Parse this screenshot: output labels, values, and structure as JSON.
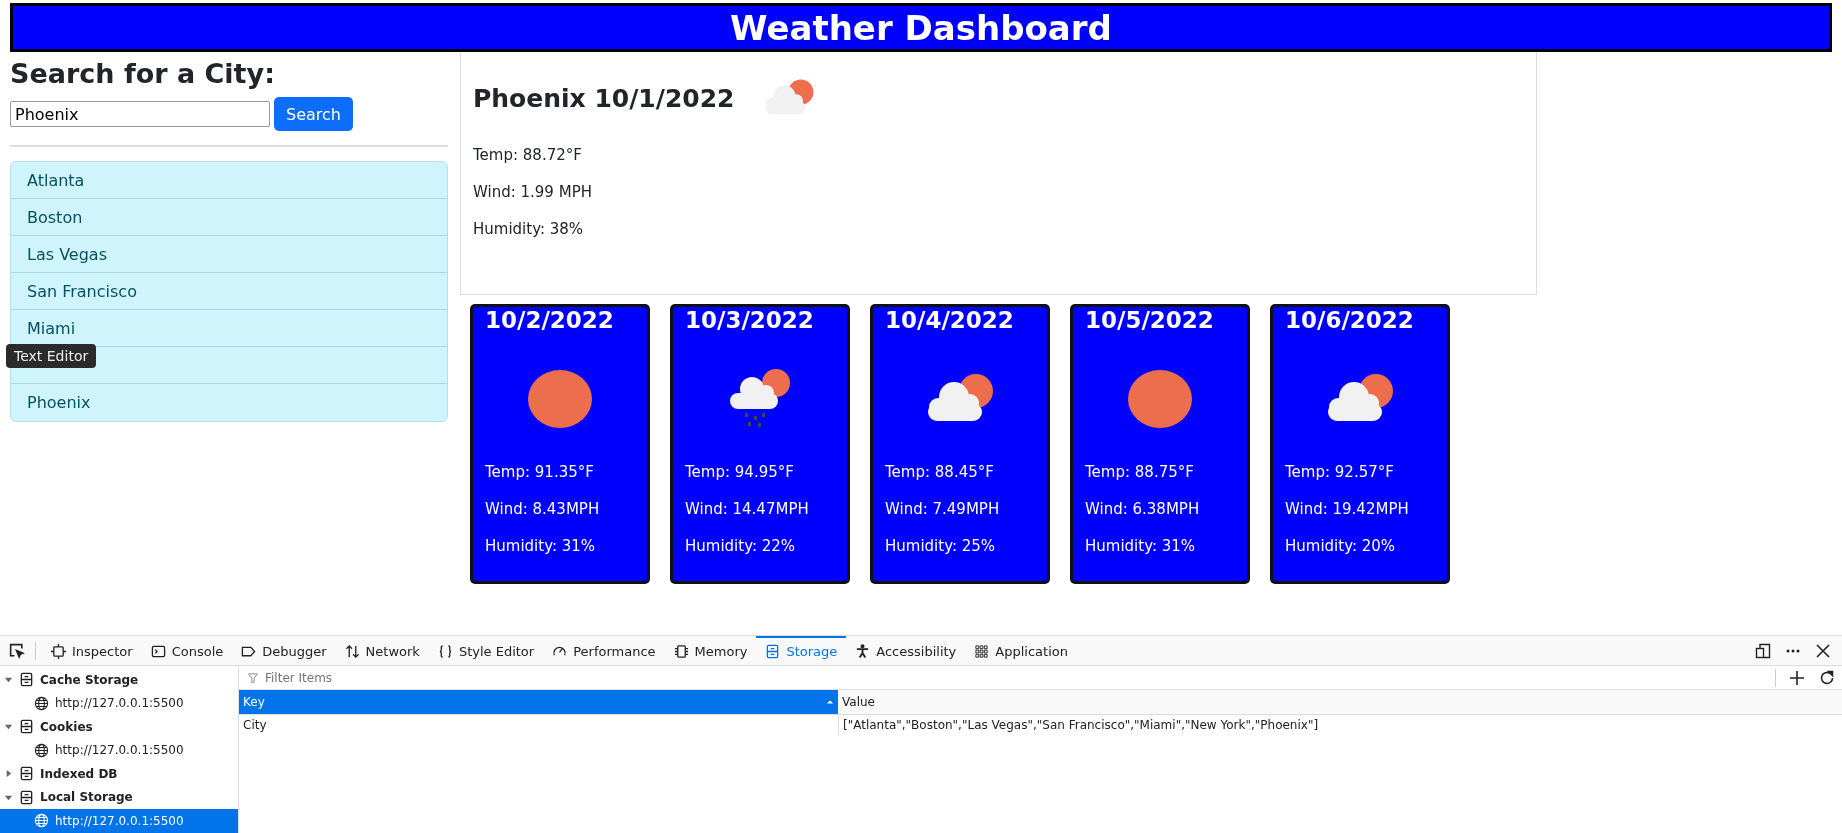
{
  "header": {
    "title": "Weather Dashboard"
  },
  "search": {
    "heading": "Search for a City:",
    "value": "Phoenix",
    "button": "Search"
  },
  "history": [
    {
      "kind": "city",
      "label": "Atlanta"
    },
    {
      "kind": "city",
      "label": "Boston"
    },
    {
      "kind": "city",
      "label": "Las Vegas"
    },
    {
      "kind": "city",
      "label": "San Francisco"
    },
    {
      "kind": "city",
      "label": "Miami"
    },
    {
      "kind": "covered"
    },
    {
      "kind": "city",
      "label": "Phoenix"
    }
  ],
  "tooltip": {
    "text": "Text Editor"
  },
  "current": {
    "title": "Phoenix 10/1/2022",
    "kind": "clouds",
    "temp": "Temp: 88.72°F",
    "wind": "Wind: 1.99 MPH",
    "humidity": "Humidity: 38%"
  },
  "forecast": [
    {
      "date": "10/2/2022",
      "kind": "clear",
      "temp": "Temp: 91.35°F",
      "wind": "Wind: 8.43MPH",
      "humidity": "Humidity: 31%"
    },
    {
      "date": "10/3/2022",
      "kind": "rain",
      "temp": "Temp: 94.95°F",
      "wind": "Wind: 14.47MPH",
      "humidity": "Humidity: 22%"
    },
    {
      "date": "10/4/2022",
      "kind": "clouds",
      "temp": "Temp: 88.45°F",
      "wind": "Wind: 7.49MPH",
      "humidity": "Humidity: 25%"
    },
    {
      "date": "10/5/2022",
      "kind": "clear",
      "temp": "Temp: 88.75°F",
      "wind": "Wind: 6.38MPH",
      "humidity": "Humidity: 31%"
    },
    {
      "date": "10/6/2022",
      "kind": "clouds",
      "temp": "Temp: 92.57°F",
      "wind": "Wind: 19.42MPH",
      "humidity": "Humidity: 20%"
    }
  ],
  "devtools": {
    "tabs": [
      {
        "label": "Inspector",
        "kind": "inspector",
        "selected": false
      },
      {
        "label": "Console",
        "kind": "console",
        "selected": false
      },
      {
        "label": "Debugger",
        "kind": "debugger",
        "selected": false
      },
      {
        "label": "Network",
        "kind": "network",
        "selected": false
      },
      {
        "label": "Style Editor",
        "kind": "style",
        "selected": false
      },
      {
        "label": "Performance",
        "kind": "performance",
        "selected": false
      },
      {
        "label": "Memory",
        "kind": "memory",
        "selected": false
      },
      {
        "label": "Storage",
        "kind": "storage",
        "selected": true
      },
      {
        "label": "Accessibility",
        "kind": "accessibility",
        "selected": false
      },
      {
        "label": "Application",
        "kind": "application",
        "selected": false
      }
    ],
    "tree": [
      {
        "label": "Cache Storage",
        "expanded": true,
        "children": [
          {
            "label": "http://127.0.0.1:5500",
            "selected": false
          }
        ]
      },
      {
        "label": "Cookies",
        "expanded": true,
        "children": [
          {
            "label": "http://127.0.0.1:5500",
            "selected": false
          }
        ]
      },
      {
        "label": "Indexed DB",
        "expanded": false
      },
      {
        "label": "Local Storage",
        "expanded": true,
        "children": [
          {
            "label": "http://127.0.0.1:5500",
            "selected": true
          }
        ]
      }
    ],
    "filter_placeholder": "Filter Items",
    "table": {
      "columns": [
        "Key",
        "Value"
      ],
      "rows": [
        [
          "City",
          "[\"Atlanta\",\"Boston\",\"Las Vegas\",\"San Francisco\",\"Miami\",\"New York\",\"Phoenix\"]"
        ]
      ]
    }
  }
}
